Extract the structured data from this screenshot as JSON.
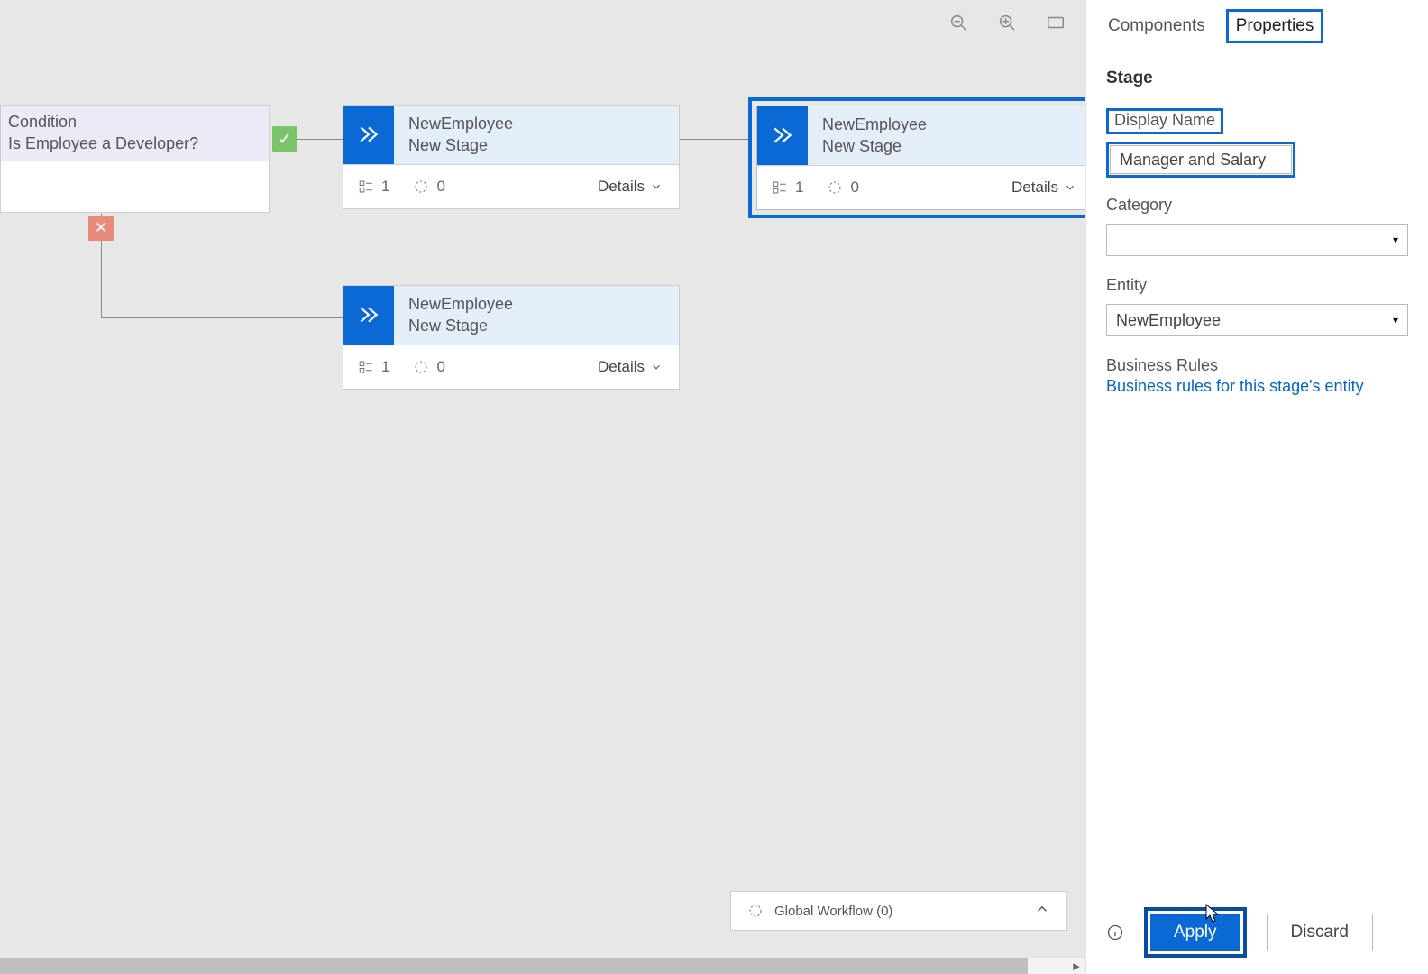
{
  "canvas": {
    "condition": {
      "type_label": "Condition",
      "text": "Is Employee a Developer?"
    },
    "stages": [
      {
        "entity": "NewEmployee",
        "name": "New Stage",
        "steps": "1",
        "workflows": "0",
        "details_label": "Details"
      },
      {
        "entity": "NewEmployee",
        "name": "New Stage",
        "steps": "1",
        "workflows": "0",
        "details_label": "Details"
      },
      {
        "entity": "NewEmployee",
        "name": "New Stage",
        "steps": "1",
        "workflows": "0",
        "details_label": "Details"
      }
    ],
    "global_workflow_label": "Global Workflow (0)"
  },
  "panel": {
    "tabs": {
      "components": "Components",
      "properties": "Properties"
    },
    "section": "Stage",
    "display_name_label": "Display Name",
    "display_name_value": "Manager and Salary",
    "category_label": "Category",
    "category_value": "",
    "entity_label": "Entity",
    "entity_value": "NewEmployee",
    "business_rules_label": "Business Rules",
    "business_rules_link": "Business rules for this stage's entity",
    "apply_label": "Apply",
    "discard_label": "Discard"
  }
}
